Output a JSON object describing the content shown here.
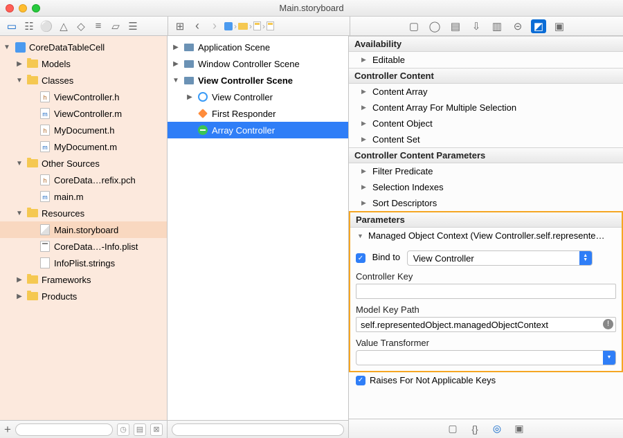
{
  "window": {
    "title": "Main.storyboard"
  },
  "breadcrumb": [],
  "navigator": {
    "project": "CoreDataTableCell",
    "tree": [
      {
        "label": "Models",
        "type": "folder",
        "open": false,
        "depth": 1
      },
      {
        "label": "Classes",
        "type": "folder",
        "open": true,
        "depth": 1
      },
      {
        "label": "ViewController.h",
        "type": "h",
        "depth": 2
      },
      {
        "label": "ViewController.m",
        "type": "m",
        "depth": 2
      },
      {
        "label": "MyDocument.h",
        "type": "h",
        "depth": 2
      },
      {
        "label": "MyDocument.m",
        "type": "m",
        "depth": 2
      },
      {
        "label": "Other Sources",
        "type": "folder",
        "open": true,
        "depth": 1
      },
      {
        "label": "CoreData…refix.pch",
        "type": "h",
        "depth": 2
      },
      {
        "label": "main.m",
        "type": "m",
        "depth": 2
      },
      {
        "label": "Resources",
        "type": "folder",
        "open": true,
        "depth": 1
      },
      {
        "label": "Main.storyboard",
        "type": "sb",
        "depth": 2,
        "selected": true
      },
      {
        "label": "CoreData…-Info.plist",
        "type": "plist",
        "depth": 2
      },
      {
        "label": "InfoPlist.strings",
        "type": "doc",
        "depth": 2
      },
      {
        "label": "Frameworks",
        "type": "folder",
        "open": false,
        "depth": 1
      },
      {
        "label": "Products",
        "type": "folder",
        "open": false,
        "depth": 1
      }
    ]
  },
  "outline": {
    "items": [
      {
        "label": "Application Scene",
        "type": "scene",
        "open": false,
        "depth": 0
      },
      {
        "label": "Window Controller Scene",
        "type": "scene",
        "open": false,
        "depth": 0
      },
      {
        "label": "View Controller Scene",
        "type": "scene",
        "open": true,
        "depth": 0,
        "bold": true
      },
      {
        "label": "View Controller",
        "type": "vc",
        "open": false,
        "depth": 1
      },
      {
        "label": "First Responder",
        "type": "cube",
        "depth": 1
      },
      {
        "label": "Array Controller",
        "type": "green",
        "depth": 1,
        "selected": true
      }
    ]
  },
  "inspector": {
    "sections": {
      "availability": {
        "title": "Availability",
        "items": [
          "Editable"
        ]
      },
      "controllerContent": {
        "title": "Controller Content",
        "items": [
          "Content Array",
          "Content Array For Multiple Selection",
          "Content Object",
          "Content Set"
        ]
      },
      "controllerContentParams": {
        "title": "Controller Content Parameters",
        "items": [
          "Filter Predicate",
          "Selection Indexes",
          "Sort Descriptors"
        ]
      },
      "parameters": {
        "title": "Parameters",
        "moc_label": "Managed Object Context (View Controller.self.represente…",
        "bind_to_label": "Bind to",
        "bind_to_value": "View Controller",
        "controller_key_label": "Controller Key",
        "controller_key_value": "",
        "model_key_path_label": "Model Key Path",
        "model_key_path_value": "self.representedObject.managedObjectContext",
        "value_transformer_label": "Value Transformer",
        "value_transformer_value": ""
      },
      "raises_label": "Raises For Not Applicable Keys"
    }
  }
}
